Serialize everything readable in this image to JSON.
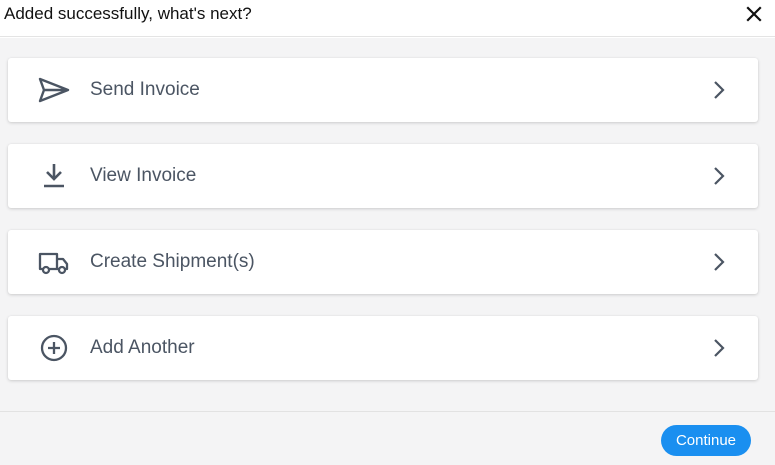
{
  "dialog": {
    "title": "Added successfully, what's next?",
    "close_icon": "close-icon"
  },
  "options": [
    {
      "label": "Send Invoice",
      "icon": "send-icon"
    },
    {
      "label": "View Invoice",
      "icon": "download-icon"
    },
    {
      "label": "Create Shipment(s)",
      "icon": "truck-icon"
    },
    {
      "label": "Add Another",
      "icon": "add-circle-icon"
    }
  ],
  "footer": {
    "continue_label": "Continue"
  },
  "colors": {
    "accent": "#1a8ff0",
    "text_primary": "#111111",
    "text_secondary": "#4b5563",
    "background": "#f4f4f5"
  }
}
